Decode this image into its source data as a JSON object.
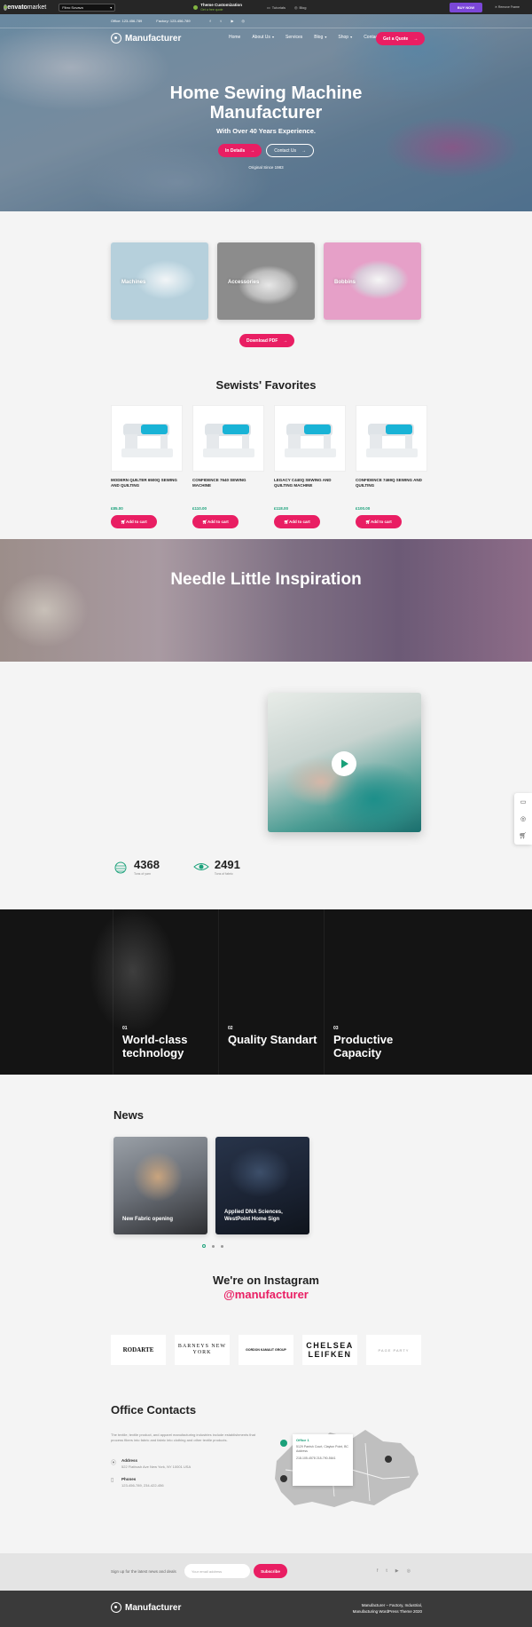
{
  "envato": {
    "logo_main": "envato",
    "logo_market": "market",
    "select_label": "Fibro Sovava",
    "promo_title": "Theme Customization",
    "promo_sub": "Get a free quote",
    "link_tutorials": "Tutorials",
    "link_blog": "Blog",
    "buy_now": "BUY NOW",
    "remove_frame": "Remove Frame"
  },
  "topline": {
    "office": "Office: 123-456-789",
    "factory": "Factory: 123-456-789"
  },
  "header": {
    "logo": "Manufacturer",
    "menu": [
      "Home",
      "About Us",
      "Services",
      "Blog",
      "Shop",
      "Contacts"
    ],
    "quote_button": "Get a Quote"
  },
  "hero": {
    "title": "Home Sewing Machine Manufacturer",
    "subtitle": "With Over 40 Years Experience.",
    "btn_details": "In Details",
    "btn_contact": "Contact Us",
    "since": "Original Since 1983"
  },
  "categories": [
    "Machines",
    "Accessories",
    "Bobbins"
  ],
  "download_btn": "Download PDF",
  "favorites": {
    "title": "Sewists' Favorites",
    "cart_label": "Add to cart",
    "products": [
      {
        "name": "MODERN QUILTER 6500Q SEWING AND QUILTING",
        "price": "£85.00"
      },
      {
        "name": "CONFIDENCE 7640 SEWING MACHINE",
        "price": "£110.00"
      },
      {
        "name": "LEGACY C440Q SEWING AND QUILTING MACHINE",
        "price": "£118.00"
      },
      {
        "name": "CONFIDENCE 7469Q SEWING AND QUILTING",
        "price": "£100.00"
      }
    ]
  },
  "inspiration": {
    "title": "Needle Little Inspiration"
  },
  "stats": [
    {
      "num": "4368",
      "label": "Tons of yarn",
      "icon": "yarn-icon"
    },
    {
      "num": "2491",
      "label": "Tons of fabric",
      "icon": "eye-icon"
    }
  ],
  "features": [
    {
      "num": "01",
      "title": "World-class technology"
    },
    {
      "num": "02",
      "title": "Quality Standart"
    },
    {
      "num": "03",
      "title": "Productive Capacity"
    }
  ],
  "news": {
    "title": "News",
    "items": [
      "New Fabric opening",
      "Applied DNA Sciences, WestPoint Home Sign"
    ]
  },
  "instagram": {
    "title": "We're on Instagram",
    "handle": "@manufacturer"
  },
  "brands": [
    "RODARTE",
    "BARNEYS NEW YORK",
    "GORDON KAMAUT GROUP",
    "CHELSEA LEIFKEN",
    "PAGE PARTY"
  ],
  "office": {
    "title": "Office Contacts",
    "desc": "The textile, textile product, and apparel manufacturing industries include establishments that process fibers into fabric and fabric into clothing and other textile products.",
    "address_label": "Address",
    "address": "522 Flatbush Ave New York, NY 10001 USA",
    "phones_label": "Phones",
    "phones": "123-456-789, 234-422-456",
    "map_card_title": "Office 1",
    "map_card_text": "5129 Parrish Court, Clayton Point, BC Address",
    "map_card_phone": "218-105-4578 218-790-5641"
  },
  "footer": {
    "sub_text": "Sign up for the latest news and deals",
    "sub_placeholder": "Your email address",
    "sub_btn": "Subscribe",
    "logo": "Manufacturer",
    "copy1": "Manufacturer – Factory, Industrial,",
    "copy2": "Manufacturing WordPress Theme 2020"
  },
  "colors": {
    "accent": "#e91e63",
    "green": "#1aa17a",
    "dark": "#141414"
  }
}
